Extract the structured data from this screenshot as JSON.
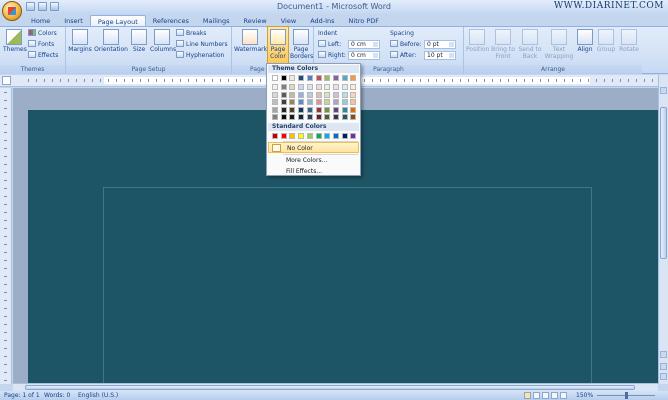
{
  "window": {
    "title": "Document1 - Microsoft Word",
    "watermark": "WWW.DIARINET.COM"
  },
  "tabs": [
    "Home",
    "Insert",
    "Page Layout",
    "References",
    "Mailings",
    "Review",
    "View",
    "Add-Ins",
    "Nitro PDF"
  ],
  "active_tab": "Page Layout",
  "ribbon": {
    "themes": {
      "group_label": "Themes",
      "big": "Themes",
      "colors": "Colors",
      "fonts": "Fonts",
      "effects": "Effects"
    },
    "page_setup": {
      "group_label": "Page Setup",
      "margins": "Margins",
      "orientation": "Orientation",
      "size": "Size",
      "columns": "Columns",
      "breaks": "Breaks",
      "line_numbers": "Line Numbers",
      "hyphenation": "Hyphenation"
    },
    "page_background": {
      "group_label": "Page B",
      "watermark": "Watermark",
      "page_color_1": "Page",
      "page_color_2": "Color",
      "page_borders_1": "Page",
      "page_borders_2": "Borders"
    },
    "paragraph": {
      "group_label": "Paragraph",
      "indent": "Indent",
      "left_label": "Left:",
      "left_value": "0 cm",
      "right_label": "Right:",
      "right_value": "0 cm",
      "spacing": "Spacing",
      "before_label": "Before:",
      "before_value": "0 pt",
      "after_label": "After:",
      "after_value": "10 pt"
    },
    "arrange": {
      "group_label": "Arrange",
      "position": "Position",
      "bring_front_1": "Bring to",
      "bring_front_2": "Front",
      "send_back_1": "Send to",
      "send_back_2": "Back",
      "text_wrap_1": "Text",
      "text_wrap_2": "Wrapping",
      "align": "Align",
      "group": "Group",
      "rotate": "Rotate"
    }
  },
  "dropdown": {
    "theme_colors_label": "Theme Colors",
    "standard_colors_label": "Standard Colors",
    "no_color": "No Color",
    "more_colors": "More Colors...",
    "fill_effects": "Fill Effects...",
    "theme_top_row": [
      "#ffffff",
      "#000000",
      "#eeece1",
      "#1f497d",
      "#4f81bd",
      "#c0504d",
      "#9bbb59",
      "#8064a2",
      "#4bacc6",
      "#f79646"
    ],
    "theme_shades": [
      [
        "#f2f2f2",
        "#7f7f7f",
        "#ddd9c3",
        "#c6d9f0",
        "#dbe5f1",
        "#f2dcdb",
        "#ebf1dd",
        "#e5e0ec",
        "#dbeef3",
        "#fdeada"
      ],
      [
        "#d8d8d8",
        "#595959",
        "#c4bd97",
        "#8db3e2",
        "#b8cce4",
        "#e5b9b7",
        "#d7e3bc",
        "#ccc1d9",
        "#b7dde8",
        "#fbd5b5"
      ],
      [
        "#bfbfbf",
        "#3f3f3f",
        "#938953",
        "#548dd4",
        "#95b3d7",
        "#d99694",
        "#c3d69b",
        "#b2a2c7",
        "#92cddc",
        "#fac08f"
      ],
      [
        "#a5a5a5",
        "#262626",
        "#494429",
        "#17365d",
        "#366092",
        "#953734",
        "#76923c",
        "#5f497a",
        "#31859b",
        "#e36c09"
      ],
      [
        "#7f7f7f",
        "#0c0c0c",
        "#1d1b10",
        "#0f243e",
        "#244061",
        "#632423",
        "#4f6128",
        "#3f3151",
        "#205867",
        "#974806"
      ]
    ],
    "standard": [
      "#c00000",
      "#ff0000",
      "#ffc000",
      "#ffff00",
      "#92d050",
      "#00b050",
      "#00b0f0",
      "#0070c0",
      "#002060",
      "#7030a0"
    ]
  },
  "status": {
    "page": "Page: 1 of 1",
    "words": "Words: 0",
    "language": "English (U.S.)",
    "zoom": "150%"
  },
  "colors": {
    "page_background": "#1e5566",
    "ribbon": "#d3e2f6",
    "accent": "#ffc95a"
  }
}
